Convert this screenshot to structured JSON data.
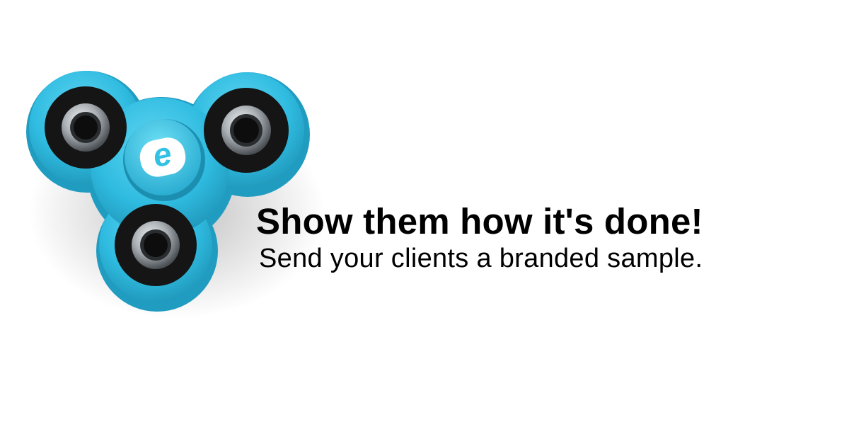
{
  "banner": {
    "headline": "Show them how it's done!",
    "subline": "Send your clients a branded sample."
  },
  "product_image": {
    "icon": "fidget-spinner-icon",
    "logo_letter": "e",
    "color": "#33c2e4"
  },
  "colors": {
    "background": "#ffffff",
    "text": "#000000",
    "spinner_body": "#33c2e4",
    "bearing_ring": "#151515"
  }
}
